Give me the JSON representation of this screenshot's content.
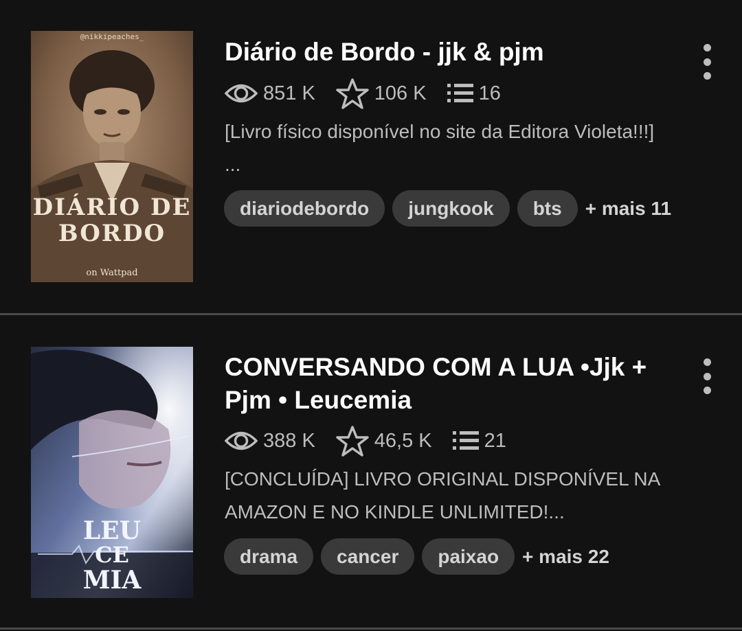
{
  "colors": {
    "background": "#121212",
    "tag_bg": "#3a3a3a",
    "divider": "#4a4a4a",
    "meta_text": "#bdbdbd"
  },
  "stories": [
    {
      "title": "Diário de Bordo - jjk & pjm",
      "reads": "851 K",
      "votes": "106 K",
      "parts": "16",
      "description_lines": [
        "[Livro físico disponível no site da Editora Violeta!!!]",
        "..."
      ],
      "tags": [
        "diariodebordo",
        "jungkook",
        "bts"
      ],
      "more_tags": "+ mais 11",
      "cover": {
        "handle": "@nikkipeaches_",
        "title_lines": [
          "DIÁRIO DE",
          "BORDO"
        ],
        "footer": "on Wattpad"
      }
    },
    {
      "title_lines": [
        "CONVERSANDO COM A LUA  •Jjk +",
        "Pjm • Leucemia"
      ],
      "reads": "388 K",
      "votes": "46,5 K",
      "parts": "21",
      "description_lines": [
        "[CONCLUÍDA] LIVRO ORIGINAL DISPONÍVEL NA",
        "AMAZON E NO KINDLE UNLIMITED!..."
      ],
      "tags": [
        "drama",
        "cancer",
        "paixao"
      ],
      "more_tags": "+ mais 22",
      "cover": {
        "title_lines": [
          "LEU",
          "CE",
          "MIA"
        ]
      }
    }
  ],
  "icons": {
    "reads": "eye-icon",
    "votes": "star-icon",
    "parts": "list-icon",
    "menu": "more-vertical-icon"
  }
}
